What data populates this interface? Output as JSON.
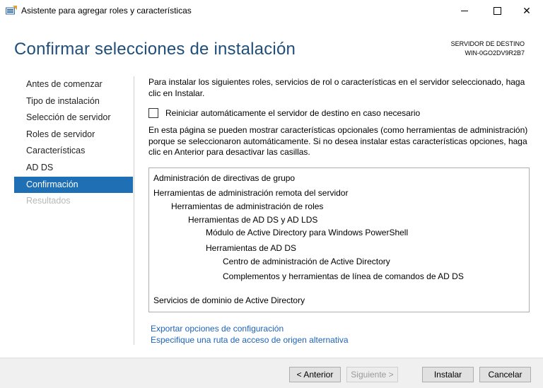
{
  "window": {
    "title": "Asistente para agregar roles y características",
    "min_icon": "minimize-icon",
    "max_icon": "maximize-icon",
    "close_icon": "close-icon",
    "close_glyph": "✕"
  },
  "header": {
    "title": "Confirmar selecciones de instalación",
    "server_label": "SERVIDOR DE DESTINO",
    "server_name": "WIN-0GO2DV9R2B7"
  },
  "nav": {
    "items": [
      {
        "label": "Antes de comenzar"
      },
      {
        "label": "Tipo de instalación"
      },
      {
        "label": "Selección de servidor"
      },
      {
        "label": "Roles de servidor"
      },
      {
        "label": "Características"
      },
      {
        "label": "AD DS"
      },
      {
        "label": "Confirmación"
      },
      {
        "label": "Resultados"
      }
    ]
  },
  "main": {
    "intro": "Para instalar los siguientes roles, servicios de rol o características en el servidor seleccionado, haga clic en Instalar.",
    "restart_checkbox": "Reiniciar automáticamente el servidor de destino en caso necesario",
    "info": "En esta página se pueden mostrar características opcionales (como herramientas de administración) porque se seleccionaron automáticamente. Si no desea instalar estas características opciones, haga clic en Anterior para desactivar las casillas.",
    "items": [
      "Administración de directivas de grupo",
      "Herramientas de administración remota del servidor",
      "Herramientas de administración de roles",
      "Herramientas de AD DS y AD LDS",
      "Módulo de Active Directory para Windows PowerShell",
      "Herramientas de AD DS",
      "Centro de administración de Active Directory",
      "Complementos y herramientas de línea de comandos de AD DS",
      "Servicios de dominio de Active Directory"
    ],
    "export_link": "Exportar opciones de configuración",
    "source_link": "Especifique una ruta de acceso de origen alternativa"
  },
  "footer": {
    "prev": "< Anterior",
    "next": "Siguiente >",
    "install": "Instalar",
    "cancel": "Cancelar"
  }
}
